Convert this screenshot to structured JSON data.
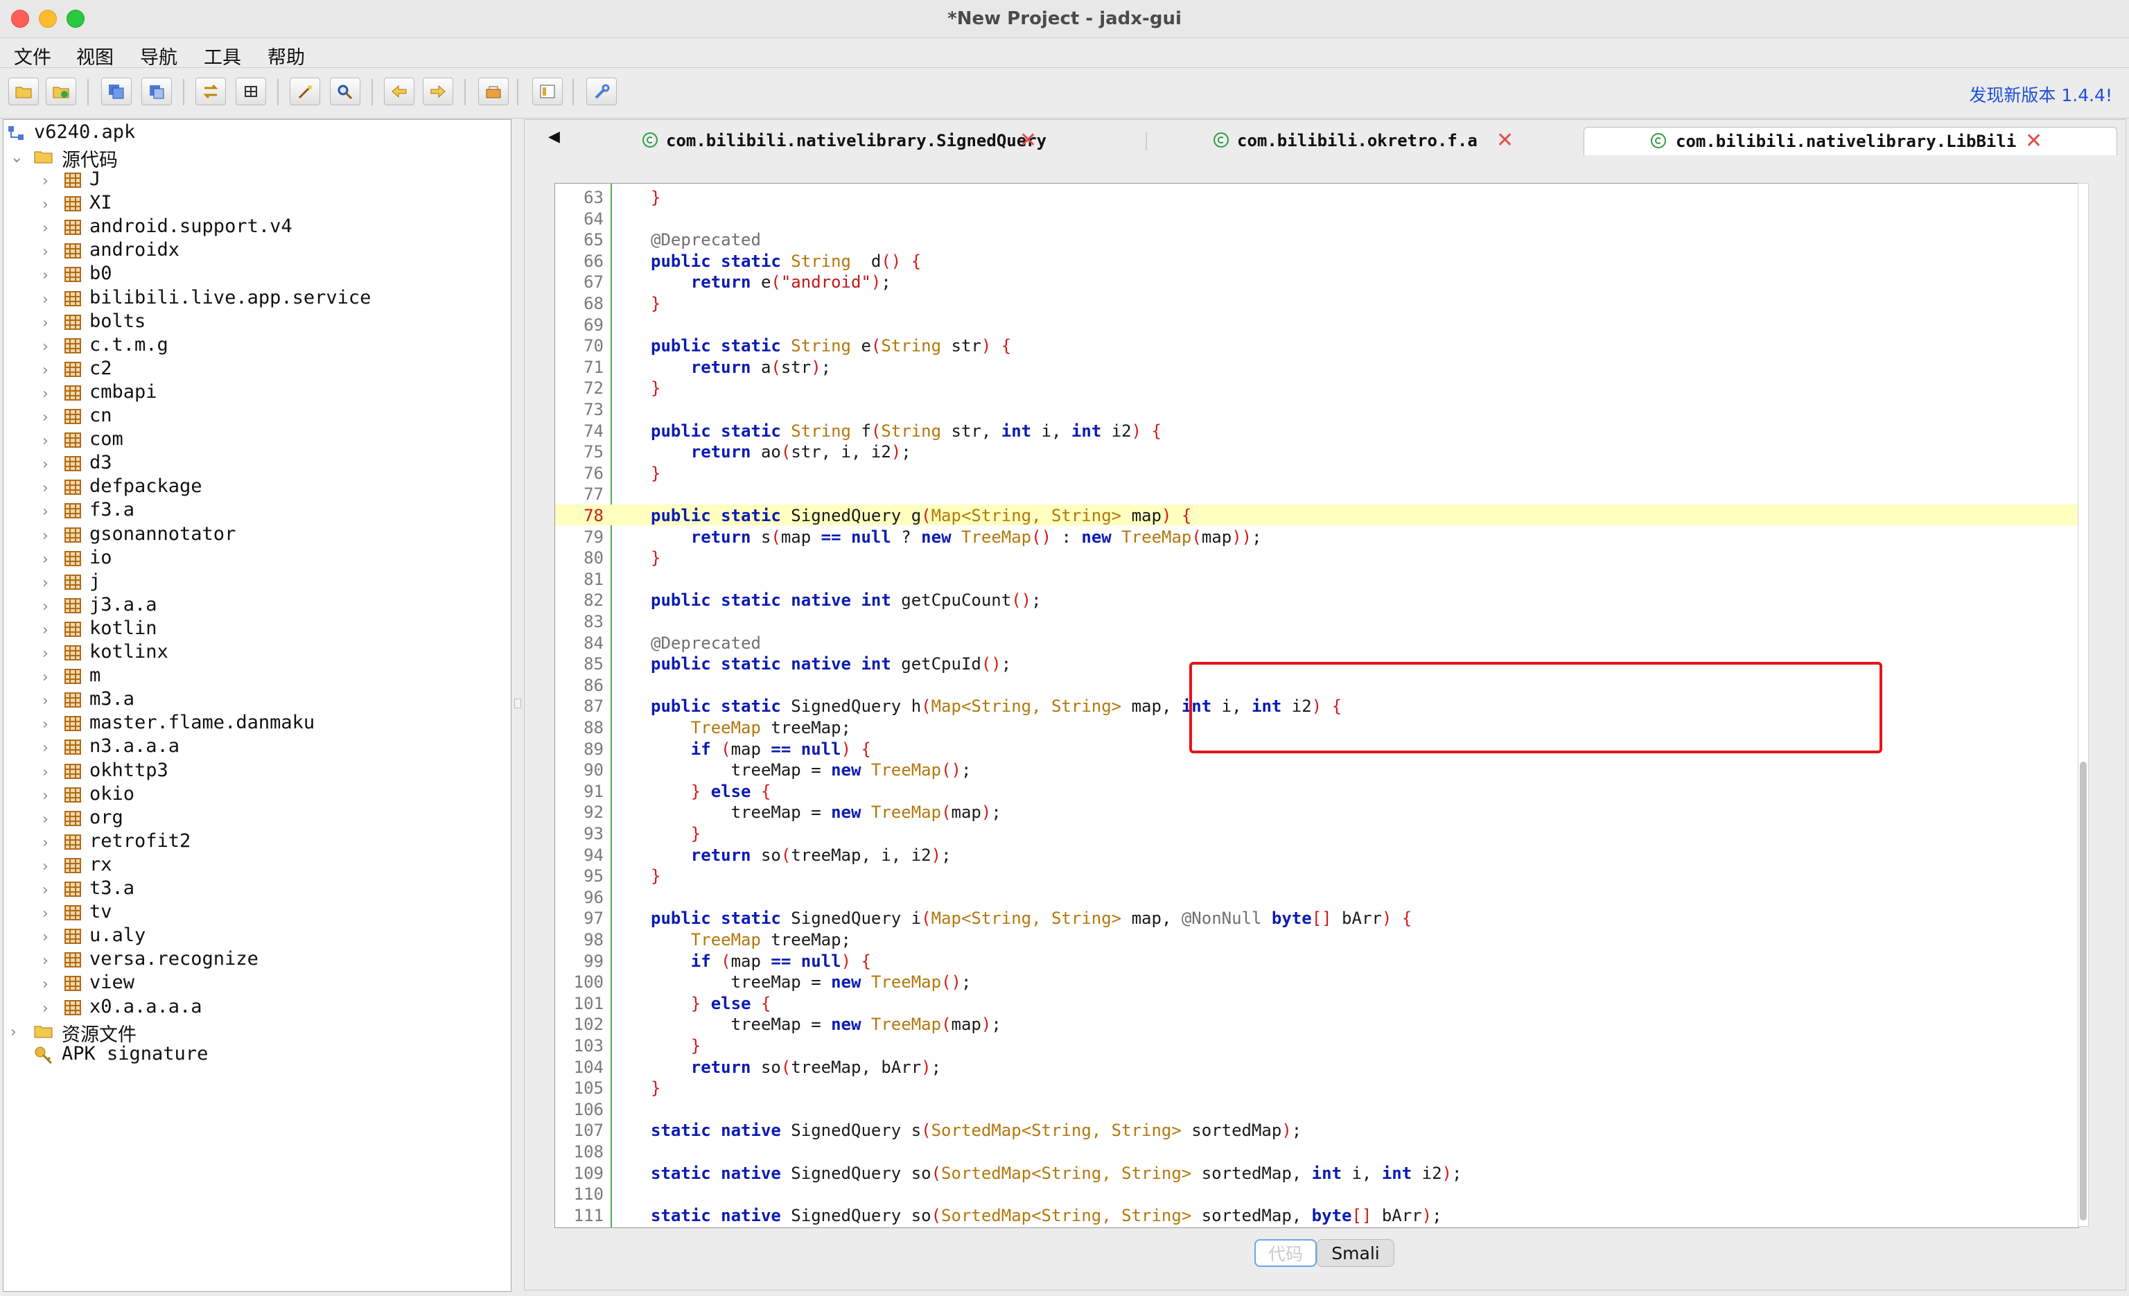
{
  "window": {
    "title": "*New Project - jadx-gui"
  },
  "menu": [
    "文件",
    "视图",
    "导航",
    "工具",
    "帮助"
  ],
  "toolbar": {
    "buttons": [
      "open-file-icon",
      "add-file-icon",
      "save-all-icon",
      "export-icon",
      "sync-icon",
      "flatten-icon",
      "wand-icon",
      "search-icon",
      "back-icon",
      "forward-icon",
      "decompile-icon",
      "log-icon",
      "settings-icon"
    ],
    "update_link": "发现新版本 1.4.4!"
  },
  "tree": {
    "root": "v6240.apk",
    "source_folder": "源代码",
    "packages": [
      "J",
      "XI",
      "android.support.v4",
      "androidx",
      "b0",
      "bilibili.live.app.service",
      "bolts",
      "c.t.m.g",
      "c2",
      "cmbapi",
      "cn",
      "com",
      "d3",
      "defpackage",
      "f3.a",
      "gsonannotator",
      "io",
      "j",
      "j3.a.a",
      "kotlin",
      "kotlinx",
      "m",
      "m3.a",
      "master.flame.danmaku",
      "n3.a.a.a",
      "okhttp3",
      "okio",
      "org",
      "retrofit2",
      "rx",
      "t3.a",
      "tv",
      "u.aly",
      "versa.recognize",
      "view",
      "x0.a.a.a.a"
    ],
    "resources": "资源文件",
    "signature": "APK signature"
  },
  "tabs": [
    {
      "label": "com.bilibili.nativelibrary.SignedQuery",
      "active": false
    },
    {
      "label": "com.bilibili.okretro.f.a",
      "active": false
    },
    {
      "label": "com.bilibili.nativelibrary.LibBili",
      "active": true
    }
  ],
  "code": {
    "current_line": 78,
    "lines": [
      {
        "n": "63",
        "t": [
          [
            "br",
            "}"
          ]
        ]
      },
      {
        "n": "64",
        "t": []
      },
      {
        "n": "65",
        "t": [
          [
            "an",
            "@Deprecated"
          ]
        ]
      },
      {
        "n": "66",
        "t": [
          [
            "kw",
            "public static "
          ],
          [
            "ty",
            "String"
          ],
          [
            "",
            "  d"
          ],
          [
            "br",
            "()"
          ],
          [
            "",
            " "
          ],
          [
            "br",
            "{"
          ]
        ]
      },
      {
        "n": "67",
        "t": [
          [
            "",
            "    "
          ],
          [
            "kw",
            "return"
          ],
          [
            "",
            " e"
          ],
          [
            "br",
            "("
          ],
          [
            "st",
            "\"android\""
          ],
          [
            "br",
            ")"
          ],
          [
            "",
            ";"
          ]
        ]
      },
      {
        "n": "68",
        "t": [
          [
            "br",
            "}"
          ]
        ]
      },
      {
        "n": "69",
        "t": []
      },
      {
        "n": "70",
        "t": [
          [
            "kw",
            "public static "
          ],
          [
            "ty",
            "String"
          ],
          [
            "",
            " e"
          ],
          [
            "br",
            "("
          ],
          [
            "ty",
            "String"
          ],
          [
            "",
            " str"
          ],
          [
            "br",
            ")"
          ],
          [
            "",
            " "
          ],
          [
            "br",
            "{"
          ]
        ]
      },
      {
        "n": "71",
        "t": [
          [
            "",
            "    "
          ],
          [
            "kw",
            "return"
          ],
          [
            "",
            " a"
          ],
          [
            "br",
            "("
          ],
          [
            "",
            "str"
          ],
          [
            "br",
            ")"
          ],
          [
            "",
            ";"
          ]
        ]
      },
      {
        "n": "72",
        "t": [
          [
            "br",
            "}"
          ]
        ]
      },
      {
        "n": "73",
        "t": []
      },
      {
        "n": "74",
        "t": [
          [
            "kw",
            "public static "
          ],
          [
            "ty",
            "String"
          ],
          [
            "",
            " f"
          ],
          [
            "br",
            "("
          ],
          [
            "ty",
            "String"
          ],
          [
            "",
            " str, "
          ],
          [
            "kw",
            "int"
          ],
          [
            "",
            " i, "
          ],
          [
            "kw",
            "int"
          ],
          [
            "",
            " i2"
          ],
          [
            "br",
            ")"
          ],
          [
            "",
            " "
          ],
          [
            "br",
            "{"
          ]
        ]
      },
      {
        "n": "75",
        "t": [
          [
            "",
            "    "
          ],
          [
            "kw",
            "return"
          ],
          [
            "",
            " ao"
          ],
          [
            "br",
            "("
          ],
          [
            "",
            "str, i, i2"
          ],
          [
            "br",
            ")"
          ],
          [
            "",
            ";"
          ]
        ]
      },
      {
        "n": "76",
        "t": [
          [
            "br",
            "}"
          ]
        ]
      },
      {
        "n": "77",
        "t": []
      },
      {
        "n": "78",
        "t": [
          [
            "kw",
            "public static "
          ],
          [
            "",
            "SignedQuery g"
          ],
          [
            "br",
            "("
          ],
          [
            "ty",
            "Map<String, String>"
          ],
          [
            "",
            " map"
          ],
          [
            "br",
            ")"
          ],
          [
            "",
            " "
          ],
          [
            "br",
            "{"
          ]
        ],
        "hl": true
      },
      {
        "n": "79",
        "t": [
          [
            "",
            "    "
          ],
          [
            "kw",
            "return"
          ],
          [
            "",
            " s"
          ],
          [
            "br",
            "("
          ],
          [
            "",
            "map "
          ],
          [
            "kw",
            "== null"
          ],
          [
            "",
            " ? "
          ],
          [
            "kw",
            "new"
          ],
          [
            "",
            " "
          ],
          [
            "ty",
            "TreeMap"
          ],
          [
            "br",
            "()"
          ],
          [
            "",
            " : "
          ],
          [
            "kw",
            "new"
          ],
          [
            "",
            " "
          ],
          [
            "ty",
            "TreeMap"
          ],
          [
            "br",
            "("
          ],
          [
            "",
            "map"
          ],
          [
            "br",
            "))"
          ],
          [
            "",
            ";"
          ]
        ]
      },
      {
        "n": "80",
        "t": [
          [
            "br",
            "}"
          ]
        ]
      },
      {
        "n": "81",
        "t": []
      },
      {
        "n": "82",
        "t": [
          [
            "kw",
            "public static native "
          ],
          [
            "kw",
            "int"
          ],
          [
            "",
            " getCpuCount"
          ],
          [
            "br",
            "()"
          ],
          [
            "",
            ";"
          ]
        ]
      },
      {
        "n": "83",
        "t": []
      },
      {
        "n": "84",
        "t": [
          [
            "an",
            "@Deprecated"
          ]
        ]
      },
      {
        "n": "85",
        "t": [
          [
            "kw",
            "public static native "
          ],
          [
            "kw",
            "int"
          ],
          [
            "",
            " getCpuId"
          ],
          [
            "br",
            "()"
          ],
          [
            "",
            ";"
          ]
        ]
      },
      {
        "n": "86",
        "t": []
      },
      {
        "n": "87",
        "t": [
          [
            "kw",
            "public static "
          ],
          [
            "",
            "SignedQuery h"
          ],
          [
            "br",
            "("
          ],
          [
            "ty",
            "Map<String, String>"
          ],
          [
            "",
            " map, "
          ],
          [
            "kw",
            "int"
          ],
          [
            "",
            " i, "
          ],
          [
            "kw",
            "int"
          ],
          [
            "",
            " i2"
          ],
          [
            "br",
            ")"
          ],
          [
            "",
            " "
          ],
          [
            "br",
            "{"
          ]
        ]
      },
      {
        "n": "88",
        "t": [
          [
            "",
            "    "
          ],
          [
            "ty",
            "TreeMap"
          ],
          [
            "",
            " treeMap;"
          ]
        ]
      },
      {
        "n": "89",
        "t": [
          [
            "",
            "    "
          ],
          [
            "kw",
            "if"
          ],
          [
            "",
            " "
          ],
          [
            "br",
            "("
          ],
          [
            "",
            "map "
          ],
          [
            "kw",
            "== null"
          ],
          [
            "br",
            ")"
          ],
          [
            "",
            " "
          ],
          [
            "br",
            "{"
          ]
        ]
      },
      {
        "n": "90",
        "t": [
          [
            "",
            "        treeMap = "
          ],
          [
            "kw",
            "new"
          ],
          [
            "",
            " "
          ],
          [
            "ty",
            "TreeMap"
          ],
          [
            "br",
            "()"
          ],
          [
            "",
            ";"
          ]
        ]
      },
      {
        "n": "91",
        "t": [
          [
            "",
            "    "
          ],
          [
            "br",
            "}"
          ],
          [
            "",
            " "
          ],
          [
            "kw",
            "else"
          ],
          [
            "",
            " "
          ],
          [
            "br",
            "{"
          ]
        ]
      },
      {
        "n": "92",
        "t": [
          [
            "",
            "        treeMap = "
          ],
          [
            "kw",
            "new"
          ],
          [
            "",
            " "
          ],
          [
            "ty",
            "TreeMap"
          ],
          [
            "br",
            "("
          ],
          [
            "",
            "map"
          ],
          [
            "br",
            ")"
          ],
          [
            "",
            ";"
          ]
        ]
      },
      {
        "n": "93",
        "t": [
          [
            "",
            "    "
          ],
          [
            "br",
            "}"
          ]
        ]
      },
      {
        "n": "94",
        "t": [
          [
            "",
            "    "
          ],
          [
            "kw",
            "return"
          ],
          [
            "",
            " so"
          ],
          [
            "br",
            "("
          ],
          [
            "",
            "treeMap, i, i2"
          ],
          [
            "br",
            ")"
          ],
          [
            "",
            ";"
          ]
        ]
      },
      {
        "n": "95",
        "t": [
          [
            "br",
            "}"
          ]
        ]
      },
      {
        "n": "96",
        "t": []
      },
      {
        "n": "97",
        "t": [
          [
            "kw",
            "public static "
          ],
          [
            "",
            "SignedQuery i"
          ],
          [
            "br",
            "("
          ],
          [
            "ty",
            "Map<String, String>"
          ],
          [
            "",
            " map, "
          ],
          [
            "an",
            "@NonNull"
          ],
          [
            "",
            " "
          ],
          [
            "kw",
            "byte"
          ],
          [
            "br",
            "[]"
          ],
          [
            "",
            " bArr"
          ],
          [
            "br",
            ")"
          ],
          [
            "",
            " "
          ],
          [
            "br",
            "{"
          ]
        ]
      },
      {
        "n": "98",
        "t": [
          [
            "",
            "    "
          ],
          [
            "ty",
            "TreeMap"
          ],
          [
            "",
            " treeMap;"
          ]
        ]
      },
      {
        "n": "99",
        "t": [
          [
            "",
            "    "
          ],
          [
            "kw",
            "if"
          ],
          [
            "",
            " "
          ],
          [
            "br",
            "("
          ],
          [
            "",
            "map "
          ],
          [
            "kw",
            "== null"
          ],
          [
            "br",
            ")"
          ],
          [
            "",
            " "
          ],
          [
            "br",
            "{"
          ]
        ]
      },
      {
        "n": "100",
        "t": [
          [
            "",
            "        treeMap = "
          ],
          [
            "kw",
            "new"
          ],
          [
            "",
            " "
          ],
          [
            "ty",
            "TreeMap"
          ],
          [
            "br",
            "()"
          ],
          [
            "",
            ";"
          ]
        ]
      },
      {
        "n": "101",
        "t": [
          [
            "",
            "    "
          ],
          [
            "br",
            "}"
          ],
          [
            "",
            " "
          ],
          [
            "kw",
            "else"
          ],
          [
            "",
            " "
          ],
          [
            "br",
            "{"
          ]
        ]
      },
      {
        "n": "102",
        "t": [
          [
            "",
            "        treeMap = "
          ],
          [
            "kw",
            "new"
          ],
          [
            "",
            " "
          ],
          [
            "ty",
            "TreeMap"
          ],
          [
            "br",
            "("
          ],
          [
            "",
            "map"
          ],
          [
            "br",
            ")"
          ],
          [
            "",
            ";"
          ]
        ]
      },
      {
        "n": "103",
        "t": [
          [
            "",
            "    "
          ],
          [
            "br",
            "}"
          ]
        ]
      },
      {
        "n": "104",
        "t": [
          [
            "",
            "    "
          ],
          [
            "kw",
            "return"
          ],
          [
            "",
            " so"
          ],
          [
            "br",
            "("
          ],
          [
            "",
            "treeMap, bArr"
          ],
          [
            "br",
            ")"
          ],
          [
            "",
            ";"
          ]
        ]
      },
      {
        "n": "105",
        "t": [
          [
            "br",
            "}"
          ]
        ]
      },
      {
        "n": "106",
        "t": []
      },
      {
        "n": "107",
        "t": [
          [
            "kw",
            "static native "
          ],
          [
            "",
            "SignedQuery s"
          ],
          [
            "br",
            "("
          ],
          [
            "ty",
            "SortedMap<String, String>"
          ],
          [
            "",
            " sortedMap"
          ],
          [
            "br",
            ")"
          ],
          [
            "",
            ";"
          ]
        ]
      },
      {
        "n": "108",
        "t": []
      },
      {
        "n": "109",
        "t": [
          [
            "kw",
            "static native "
          ],
          [
            "",
            "SignedQuery so"
          ],
          [
            "br",
            "("
          ],
          [
            "ty",
            "SortedMap<String, String>"
          ],
          [
            "",
            " sortedMap, "
          ],
          [
            "kw",
            "int"
          ],
          [
            "",
            " i, "
          ],
          [
            "kw",
            "int"
          ],
          [
            "",
            " i2"
          ],
          [
            "br",
            ")"
          ],
          [
            "",
            ";"
          ]
        ]
      },
      {
        "n": "110",
        "t": []
      },
      {
        "n": "111",
        "t": [
          [
            "kw",
            "static native "
          ],
          [
            "",
            "SignedQuery so"
          ],
          [
            "br",
            "("
          ],
          [
            "ty",
            "SortedMap<String, String>"
          ],
          [
            "",
            " sortedMap, "
          ],
          [
            "kw",
            "byte"
          ],
          [
            "br",
            "[]"
          ],
          [
            "",
            " bArr"
          ],
          [
            "br",
            ")"
          ],
          [
            "",
            ";"
          ]
        ]
      },
      {
        "n": "112",
        "t": [
          [
            "br",
            "}"
          ]
        ]
      }
    ]
  },
  "bottom_tabs": {
    "code": "代码",
    "smali": "Smali"
  },
  "colors": {
    "highlight": "#ffffbf",
    "callout": "#e8121a",
    "keyword": "#0b1bb4",
    "type": "#b3780c"
  }
}
